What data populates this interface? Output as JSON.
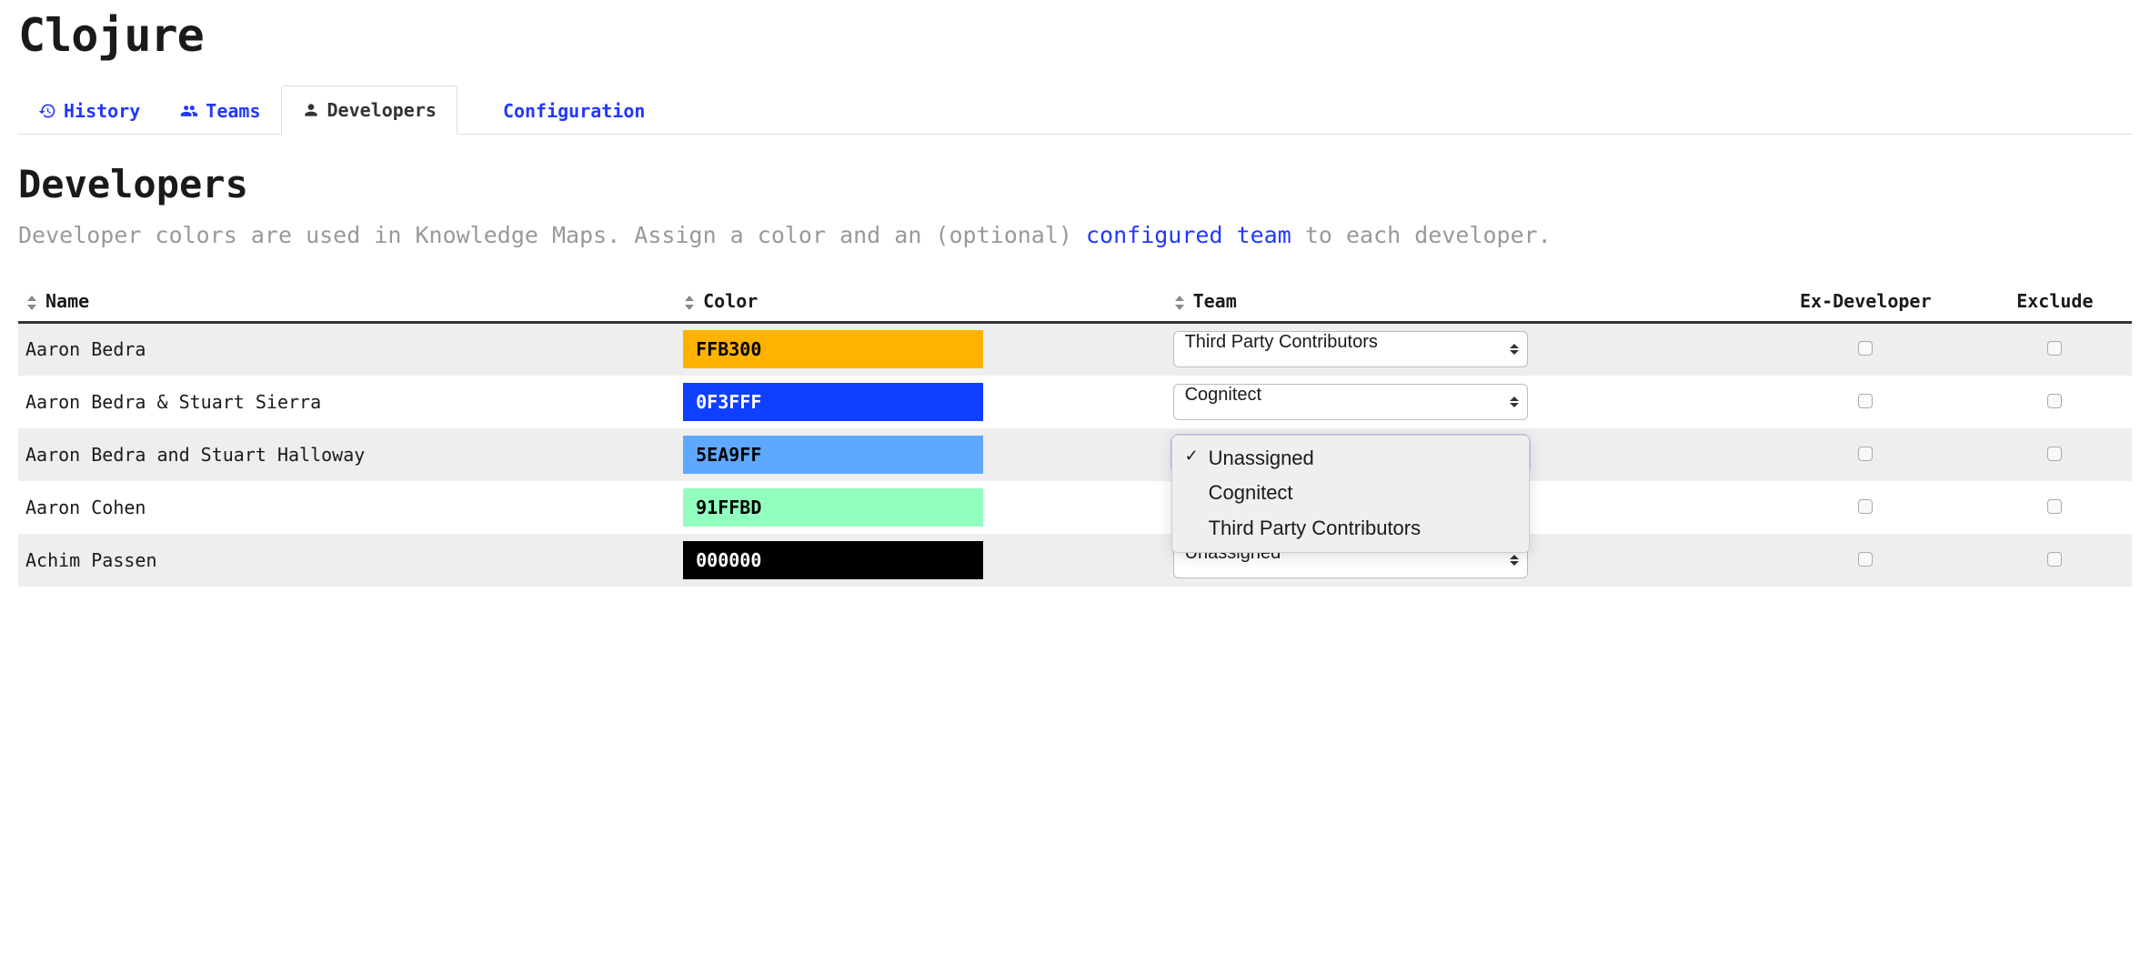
{
  "page_title": "Clojure",
  "tabs": [
    {
      "label": "History",
      "icon": "history-icon"
    },
    {
      "label": "Teams",
      "icon": "users-icon"
    },
    {
      "label": "Developers",
      "icon": "user-icon",
      "active": true
    },
    {
      "label": "Configuration",
      "icon": "cogs-icon"
    }
  ],
  "section": {
    "title": "Developers",
    "desc_before": "Developer colors are used in Knowledge Maps. Assign a color and an (optional) ",
    "desc_link": "configured team",
    "desc_after": " to each developer."
  },
  "columns": {
    "name": "Name",
    "color": "Color",
    "team": "Team",
    "ex_developer": "Ex-Developer",
    "exclude": "Exclude"
  },
  "rows": [
    {
      "name": "Aaron Bedra",
      "color_hex": "FFB300",
      "color_text_dark": true,
      "team": "Third Party Contributors",
      "ex": false,
      "exclude": false
    },
    {
      "name": "Aaron Bedra & Stuart Sierra",
      "color_hex": "0F3FFF",
      "color_text_dark": false,
      "team": "Cognitect",
      "ex": false,
      "exclude": false
    },
    {
      "name": "Aaron Bedra and Stuart Halloway",
      "color_hex": "5EA9FF",
      "color_text_dark": true,
      "team": "Unassigned",
      "ex": false,
      "exclude": false,
      "dropdown_open": true
    },
    {
      "name": "Aaron Cohen",
      "color_hex": "91FFBD",
      "color_text_dark": true,
      "team": "",
      "ex": false,
      "exclude": false
    },
    {
      "name": "Achim Passen",
      "color_hex": "000000",
      "color_text_dark": false,
      "team": "Unassigned",
      "ex": false,
      "exclude": false
    }
  ],
  "dropdown": {
    "options": [
      "Unassigned",
      "Cognitect",
      "Third Party Contributors"
    ],
    "checked_index": 0
  }
}
